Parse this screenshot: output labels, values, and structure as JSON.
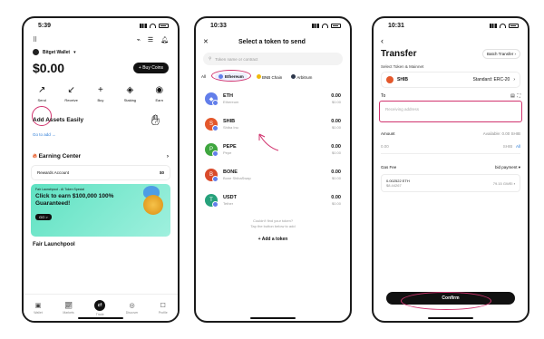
{
  "phone1": {
    "time": "5:39",
    "wallet_name": "Bitget Wallet",
    "balance": "$0.00",
    "buy_coins": "+ Buy Coins",
    "actions": [
      {
        "label": "Send",
        "icon": "↗"
      },
      {
        "label": "Receive",
        "icon": "↙"
      },
      {
        "label": "Buy",
        "icon": "+"
      },
      {
        "label": "Staking",
        "icon": "◈"
      },
      {
        "label": "Earn",
        "icon": "◉"
      }
    ],
    "add_assets_title": "Add Assets Easily",
    "go_to_add": "Go to add →",
    "earning_center": "Earning Center",
    "rewards_account": "Rewards Account",
    "rewards_value": "$0",
    "promo_small": "Fair Launchpool - AI Token Special",
    "promo_big": "Click to earn $100,000 100% Guaranteed!",
    "promo_go": "GO >",
    "fair_launchpool": "Fair Launchpool",
    "nav": [
      "Wallet",
      "Markets",
      "Trade",
      "Discover",
      "Profile"
    ]
  },
  "phone2": {
    "time": "10:33",
    "title": "Select a token to send",
    "search_placeholder": "Token name or contract",
    "chains": [
      "All",
      "Ethereum",
      "BNB Chain",
      "Arbitrum"
    ],
    "tokens": [
      {
        "symbol": "ETH",
        "name": "Ethereum",
        "amount": "0.00",
        "value": "$0.00",
        "color": "#627eea",
        "glyph": "◆"
      },
      {
        "symbol": "SHIB",
        "name": "Shiba Inu",
        "amount": "0.00",
        "value": "$0.00",
        "color": "#e4582c",
        "glyph": "S"
      },
      {
        "symbol": "PEPE",
        "name": "Pepe",
        "amount": "0.00",
        "value": "$0.00",
        "color": "#3fa63f",
        "glyph": "P"
      },
      {
        "symbol": "BONE",
        "name": "Bone ShibaSwap",
        "amount": "0.00",
        "value": "$0.00",
        "color": "#d94b2b",
        "glyph": "B"
      },
      {
        "symbol": "USDT",
        "name": "Tether",
        "amount": "0.00",
        "value": "$0.00",
        "color": "#26a17b",
        "glyph": "T"
      }
    ],
    "cant_find": "Couldn't find your token?",
    "tap_hint": "Tap the button below to add",
    "add_token": "+ Add a token"
  },
  "phone3": {
    "time": "10:31",
    "title": "Transfer",
    "batch": "Batch Transfer",
    "select_label": "Select Token & Mainnet",
    "token": "SHIB",
    "standard": "Standard: ERC-20",
    "to_label": "To",
    "recv_placeholder": "Receiving address",
    "amount_label": "Amount",
    "available": "Available: 0.00 SHIB",
    "amount_value": "0.00",
    "unit": "SHIB",
    "all": "All",
    "gas_label": "Gas Fee",
    "gas_mode": "bid payment",
    "gas_eth": "0.002522 ETH",
    "gas_usd": "$8.44267",
    "gwei": "79.15 GWEI",
    "confirm": "Confirm"
  },
  "colors": {
    "accent": "#d1336e",
    "link": "#2b7bd6",
    "promo": "#5fe2c2"
  }
}
